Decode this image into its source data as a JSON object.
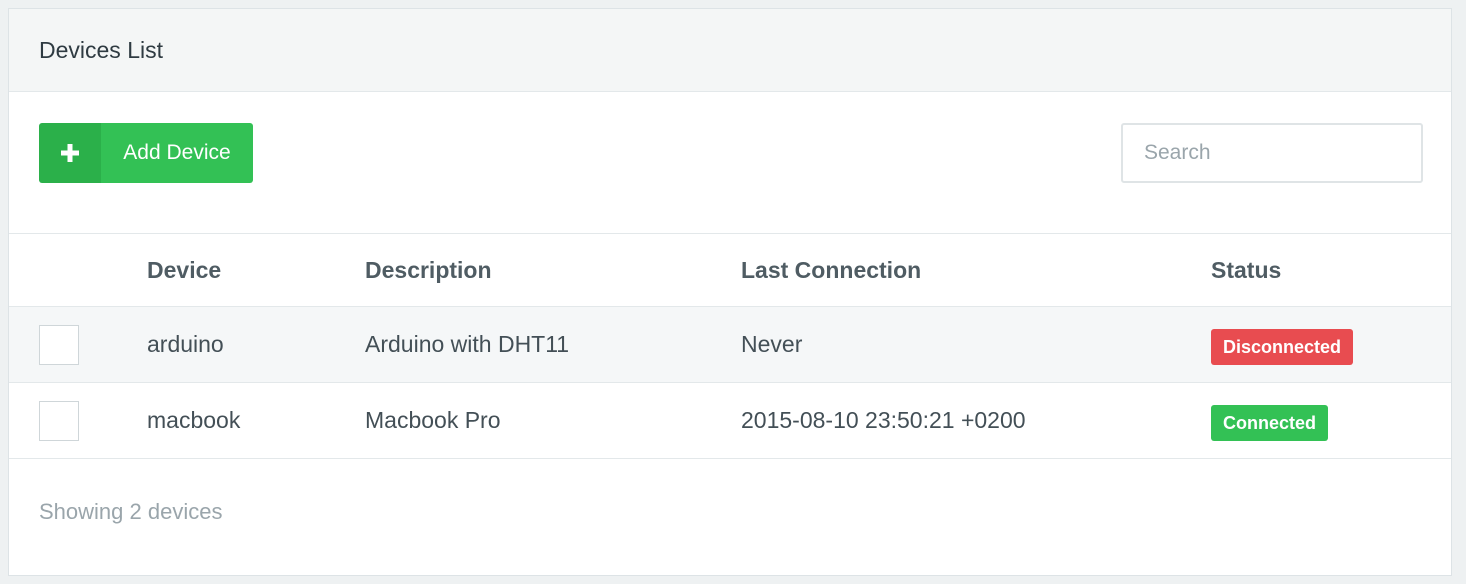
{
  "panel": {
    "title": "Devices List"
  },
  "toolbar": {
    "add_label": "Add Device",
    "add_icon": "plus-icon",
    "search_placeholder": "Search"
  },
  "table": {
    "headers": {
      "device": "Device",
      "description": "Description",
      "last_connection": "Last Connection",
      "status": "Status"
    },
    "rows": [
      {
        "device": "arduino",
        "description": "Arduino with DHT11",
        "last_connection": "Never",
        "status": "Disconnected",
        "status_color": "#e84c50"
      },
      {
        "device": "macbook",
        "description": "Macbook Pro",
        "last_connection": "2015-08-10 23:50:21 +0200",
        "status": "Connected",
        "status_color": "#33c155"
      }
    ]
  },
  "footer": {
    "summary": "Showing 2 devices"
  },
  "colors": {
    "accent_green": "#33c155",
    "accent_green_dark": "#2bb04a",
    "danger_red": "#e84c50"
  }
}
